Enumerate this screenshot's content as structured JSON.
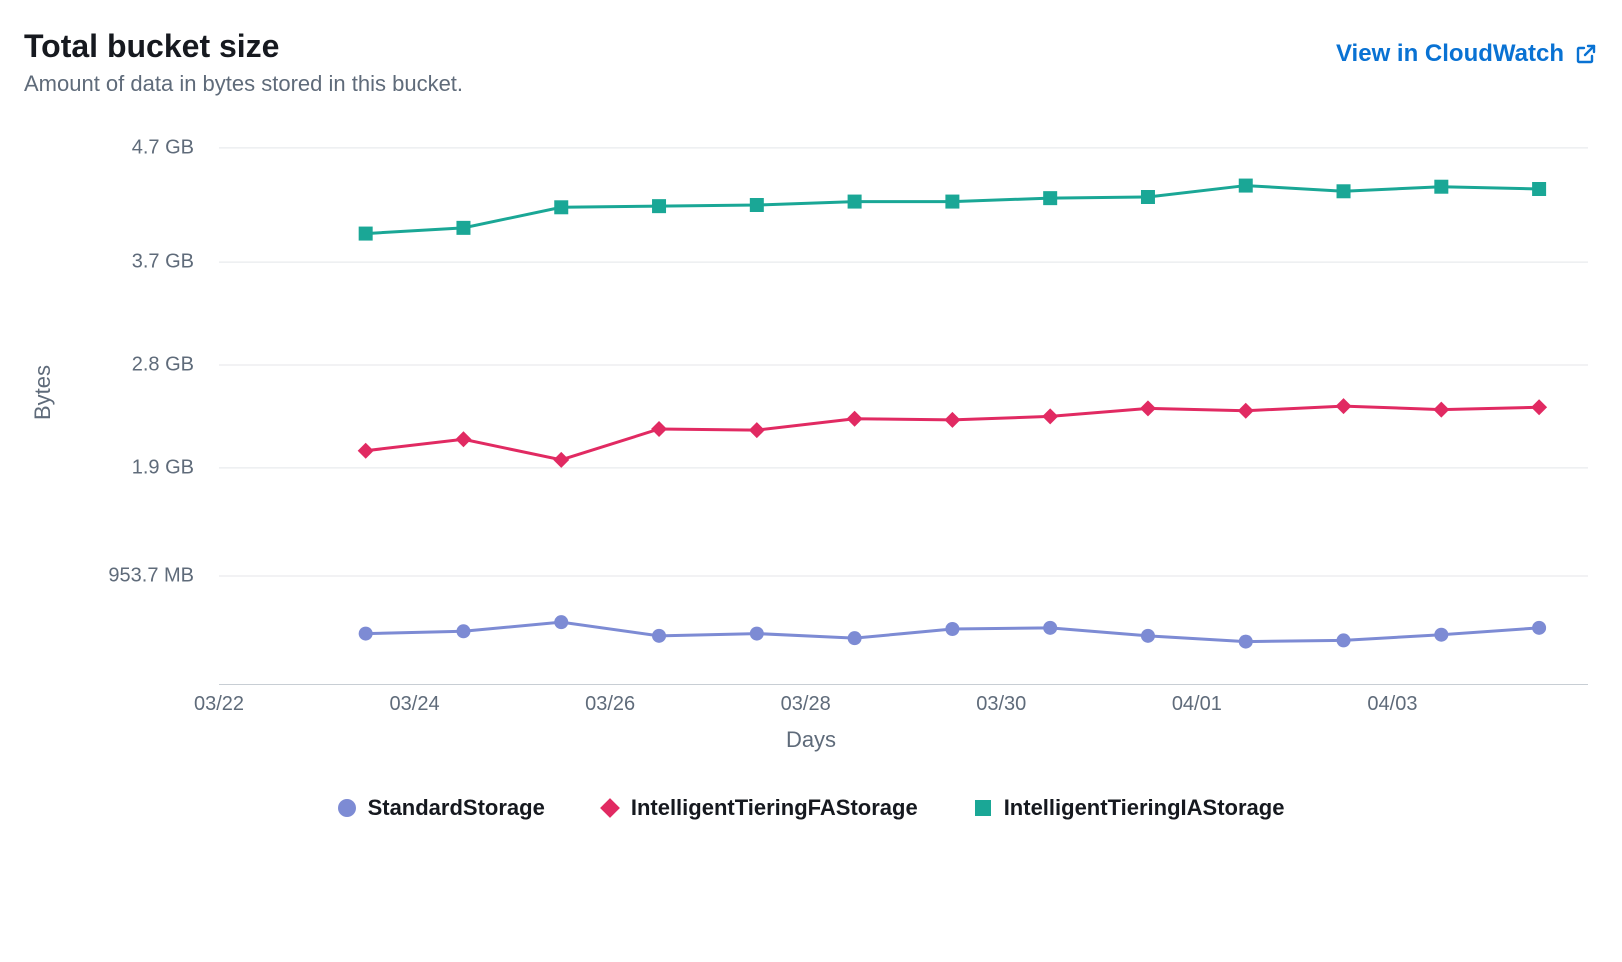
{
  "header": {
    "title": "Total bucket size",
    "subtitle": "Amount of data in bytes stored in this bucket.",
    "link_label": "View in CloudWatch"
  },
  "colors": {
    "standard": "#7d8bd4",
    "fa": "#e12a62",
    "ia": "#1aa796",
    "grid": "#e9ebed",
    "link": "#0972d3"
  },
  "chart_data": {
    "type": "line",
    "title": "Total bucket size",
    "xlabel": "Days",
    "ylabel": "Bytes",
    "x_tick_labels": [
      "03/22",
      "03/24",
      "03/26",
      "03/28",
      "03/30",
      "04/01",
      "04/03"
    ],
    "x_tick_values": [
      0,
      2,
      4,
      6,
      8,
      10,
      12
    ],
    "y_tick_labels": [
      "953.7 MB",
      "1.9 GB",
      "2.8 GB",
      "3.7 GB",
      "4.7 GB"
    ],
    "y_tick_values": [
      0.9537,
      1.9,
      2.8,
      3.7,
      4.7
    ],
    "ylim": [
      0,
      4.9
    ],
    "xlim": [
      0,
      14
    ],
    "x": [
      1.5,
      2.5,
      3.5,
      4.5,
      5.5,
      6.5,
      7.5,
      8.5,
      9.5,
      10.5,
      11.5,
      12.5,
      13.5
    ],
    "series": [
      {
        "name": "StandardStorage",
        "color_key": "standard",
        "marker": "circle",
        "values": [
          0.45,
          0.47,
          0.55,
          0.43,
          0.45,
          0.41,
          0.49,
          0.5,
          0.43,
          0.38,
          0.39,
          0.44,
          0.5
        ]
      },
      {
        "name": "IntelligentTieringFAStorage",
        "color_key": "fa",
        "marker": "diamond",
        "values": [
          2.05,
          2.15,
          1.97,
          2.24,
          2.23,
          2.33,
          2.32,
          2.35,
          2.42,
          2.4,
          2.44,
          2.41,
          2.43
        ]
      },
      {
        "name": "IntelligentTieringIAStorage",
        "color_key": "ia",
        "marker": "square",
        "values": [
          3.95,
          4.0,
          4.18,
          4.19,
          4.2,
          4.23,
          4.23,
          4.26,
          4.27,
          4.37,
          4.32,
          4.36,
          4.34
        ]
      }
    ],
    "legend_position": "bottom",
    "grid": true
  }
}
